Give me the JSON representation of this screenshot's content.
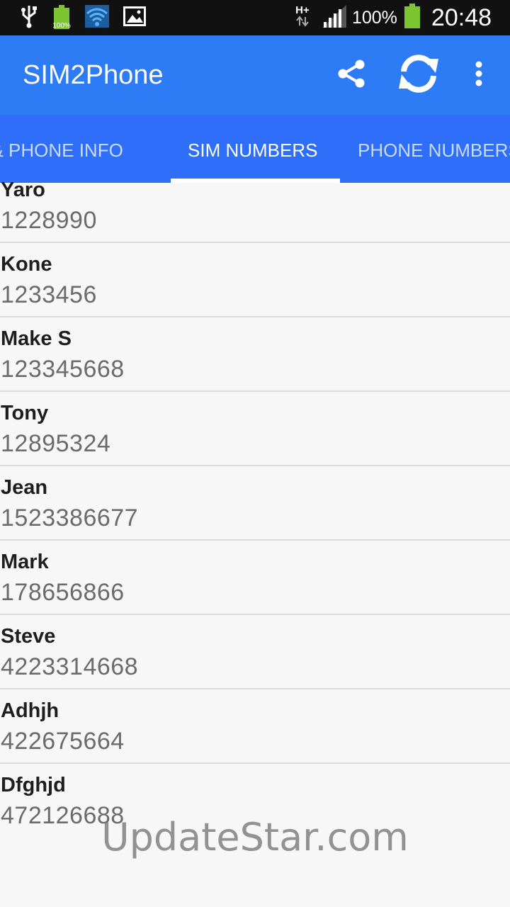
{
  "status_bar": {
    "network_label": "H+",
    "battery_small_label": "100%",
    "battery_percent": "100%",
    "time": "20:48",
    "icons": [
      "usb-icon",
      "battery-icon",
      "wifi-icon",
      "image-icon",
      "signal-icon",
      "battery-icon"
    ]
  },
  "app_bar": {
    "title": "SIM2Phone",
    "actions": [
      "share-icon",
      "sync-icon",
      "more-vert-icon"
    ]
  },
  "tabs": [
    {
      "label": "SIM & PHONE INFO"
    },
    {
      "label": "SIM NUMBERS",
      "active": true
    },
    {
      "label": "PHONE NUMBERS"
    }
  ],
  "contacts": [
    {
      "name": "Yaro",
      "number": "1228990"
    },
    {
      "name": "Kone",
      "number": "1233456"
    },
    {
      "name": "Make S",
      "number": "123345668"
    },
    {
      "name": "Tony",
      "number": "12895324"
    },
    {
      "name": "Jean",
      "number": "1523386677"
    },
    {
      "name": "Mark",
      "number": "178656866"
    },
    {
      "name": "Steve",
      "number": "4223314668"
    },
    {
      "name": "Adhjh",
      "number": "422675664"
    },
    {
      "name": "Dfghjd",
      "number": "472126688"
    }
  ],
  "watermark": "UpdateStar.com",
  "colors": {
    "app_bar": "#2e7bf6",
    "tab_bar": "#2f6ef8",
    "battery": "#7cc530"
  }
}
